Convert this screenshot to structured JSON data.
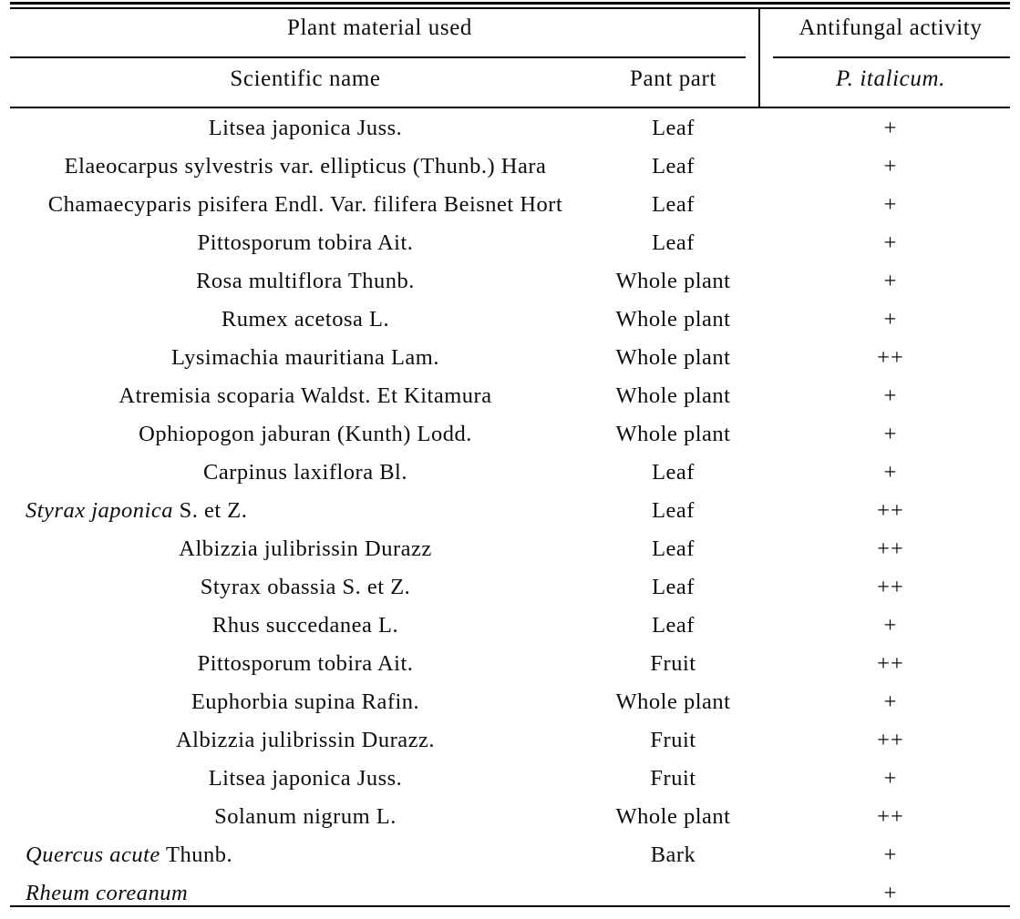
{
  "header": {
    "group_plant_material": "Plant material used",
    "group_antifungal": "Antifungal activity",
    "col_scientific_name": "Scientific name",
    "col_plant_part": "Pant part",
    "col_organism": "P. italicum."
  },
  "rows": [
    {
      "name": "Litsea japonica Juss.",
      "name_italic_part": "",
      "part": "Leaf",
      "activity": "+",
      "align": "center"
    },
    {
      "name": "Elaeocarpus sylvestris var. ellipticus (Thunb.) Hara",
      "name_italic_part": "",
      "part": "Leaf",
      "activity": "+",
      "align": "center"
    },
    {
      "name": "Chamaecyparis pisifera Endl. Var. filifera Beisnet Hort",
      "name_italic_part": "",
      "part": "Leaf",
      "activity": "+",
      "align": "center"
    },
    {
      "name": "Pittosporum tobira Ait.",
      "name_italic_part": "",
      "part": "Leaf",
      "activity": "+",
      "align": "center"
    },
    {
      "name": "Rosa multiflora Thunb.",
      "name_italic_part": "",
      "part": "Whole plant",
      "activity": "+",
      "align": "center"
    },
    {
      "name": "Rumex acetosa L.",
      "name_italic_part": "",
      "part": "Whole plant",
      "activity": "+",
      "align": "center"
    },
    {
      "name": "Lysimachia mauritiana Lam.",
      "name_italic_part": "",
      "part": "Whole plant",
      "activity": "++",
      "align": "center"
    },
    {
      "name": "Atremisia scoparia Waldst. Et Kitamura",
      "name_italic_part": "",
      "part": "Whole plant",
      "activity": "+",
      "align": "center"
    },
    {
      "name": "Ophiopogon jaburan (Kunth) Lodd.",
      "name_italic_part": "",
      "part": "Whole plant",
      "activity": "+",
      "align": "center"
    },
    {
      "name": "Carpinus laxiflora Bl.",
      "name_italic_part": "",
      "part": "Leaf",
      "activity": "+",
      "align": "center"
    },
    {
      "name": " S. et Z.",
      "name_italic_part": "Styrax  japonica",
      "part": "Leaf",
      "activity": "++",
      "align": "left"
    },
    {
      "name": "Albizzia julibrissin Durazz",
      "name_italic_part": "",
      "part": "Leaf",
      "activity": "++",
      "align": "center"
    },
    {
      "name": "Styrax obassia S. et Z.",
      "name_italic_part": "",
      "part": "Leaf",
      "activity": "++",
      "align": "center"
    },
    {
      "name": "Rhus succedanea L.",
      "name_italic_part": "",
      "part": "Leaf",
      "activity": "+",
      "align": "center"
    },
    {
      "name": "Pittosporum tobira Ait.",
      "name_italic_part": "",
      "part": "Fruit",
      "activity": "++",
      "align": "center"
    },
    {
      "name": "Euphorbia supina Rafin.",
      "name_italic_part": "",
      "part": "Whole plant",
      "activity": "+",
      "align": "center"
    },
    {
      "name": "Albizzia julibrissin Durazz.",
      "name_italic_part": "",
      "part": "Fruit",
      "activity": "++",
      "align": "center"
    },
    {
      "name": "Litsea japonica Juss.",
      "name_italic_part": "",
      "part": "Fruit",
      "activity": "+",
      "align": "center"
    },
    {
      "name": "Solanum nigrum L.",
      "name_italic_part": "",
      "part": "Whole plant",
      "activity": "++",
      "align": "center"
    },
    {
      "name": " Thunb.",
      "name_italic_part": "Quercus acute",
      "part": "Bark",
      "activity": "+",
      "align": "left"
    },
    {
      "name": "",
      "name_italic_part": "Rheum coreanum",
      "part": "",
      "activity": "+",
      "align": "left"
    }
  ],
  "colors": {
    "rule": "#000000",
    "text": "#0d0d0d",
    "background": "#ffffff"
  }
}
